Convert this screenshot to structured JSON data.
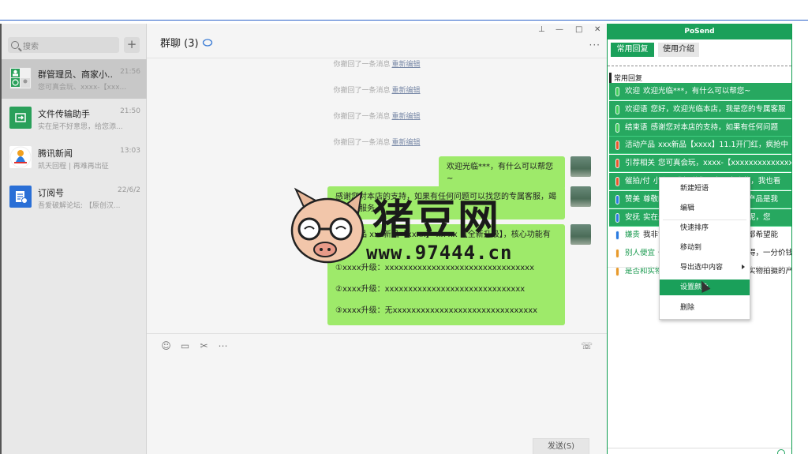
{
  "left": {
    "search_placeholder": "搜索",
    "add_label": "+",
    "conversations": [
      {
        "name": "群管理员、商家小...",
        "time": "21:56",
        "preview": "您可真会玩、xxxx-【xxx..."
      },
      {
        "name": "文件传输助手",
        "time": "21:50",
        "preview": "实在是不好意思，给您添..."
      },
      {
        "name": "腾讯新闻",
        "time": "13:03",
        "preview": "凯天回程 | 再难再出征"
      },
      {
        "name": "订阅号",
        "time": "22/6/2",
        "preview": "吾爱破解论坛: 【原创汉..."
      }
    ]
  },
  "chat": {
    "title": "群聊 (3)",
    "win_buttons": {
      "pin": "⊥",
      "min": "—",
      "max": "□",
      "close": "✕"
    },
    "more": "···",
    "system_msgs": [
      {
        "text": "你撤回了一条消息",
        "link": "重新编辑"
      },
      {
        "text": "你撤回了一条消息",
        "link": "重新编辑"
      },
      {
        "text": "你撤回了一条消息",
        "link": "重新编辑"
      },
      {
        "text": "你撤回了一条消息",
        "link": "重新编辑"
      }
    ],
    "messages": [
      {
        "text": "欢迎光临***，有什么可以帮您~"
      },
      {
        "text": "感谢您对本店的支持，如果有任何问题可以找您的专属客服，竭诚为您服务~"
      },
      {
        "lines": [
          "活动产品 xxx新品【xxxx】 xx xx 【全新升级】，核心功能有以下:",
          "①xxxx升级：xxxxxxxxxxxxxxxxxxxxxxxxxxxxxxxx",
          "②xxxx升级：xxxxxxxxxxxxxxxxxxxxxxxxxxxxxx",
          "③xxxx升级：无xxxxxxxxxxxxxxxxxxxxxxxxxxxxxxx"
        ]
      }
    ],
    "send_label": "发送(S)"
  },
  "posend": {
    "title": "PoSend",
    "tabs": [
      "常用回复",
      "使用介绍"
    ],
    "group_label": "常用回复",
    "rows": [
      {
        "kw": "欢迎",
        "text": "欢迎光临***，有什么可以帮您~",
        "color": "#3fcf5a",
        "selected": true
      },
      {
        "kw": "欢迎语",
        "text": "您好，欢迎光临本店，我是您的专属客服",
        "color": "#3fcf5a",
        "selected": true
      },
      {
        "kw": "结束语",
        "text": "感谢您对本店的支持，如果有任何问题",
        "color": "#3fcf5a",
        "selected": true
      },
      {
        "kw": "活动产品",
        "text": "xxx新品【xxxx】11.1开门红，疯抢中",
        "color": "#e8572c",
        "selected": true
      },
      {
        "kw": "引荐相关",
        "text": "您可真会玩，xxxx-【xxxxxxxxxxxxxxxx",
        "color": "#e8572c",
        "selected": true
      },
      {
        "kw": "催拍/付",
        "text": "小主，我知道您是真心喜欢的，我也看",
        "color": "#e8572c",
        "selected": true
      },
      {
        "kw": "赞美",
        "text": "尊敬的客户，您好，我家的这款产品是我",
        "color": "#2a7be0",
        "selected": true
      },
      {
        "kw": "安抚",
        "text": "实在是不好意思，给您添麻烦了呢，您",
        "color": "#2a7be0",
        "selected": true
      },
      {
        "kw": "嫌贵",
        "text": "我非常理解您的想法，当你选推都希望能",
        "color": "#2a7be0",
        "selected": false
      },
      {
        "kw": "别人便宜",
        "text": "一分钱一分货，好的产品值得，一分价钱",
        "color": "#e89a2c",
        "selected": false
      },
      {
        "kw": "是否和实物一样",
        "text": "我们家所有产品都是实物拍摄的产品材",
        "color": "#e89a2c",
        "selected": false
      }
    ]
  },
  "context_menu": {
    "items": [
      "新建短语",
      "编辑",
      "快速排序",
      "移动到",
      "导出选中内容",
      "设置颜色",
      "删除"
    ],
    "highlighted": "设置颜色"
  },
  "watermark": {
    "text": "猪豆网",
    "url": "www.97444.cn"
  }
}
